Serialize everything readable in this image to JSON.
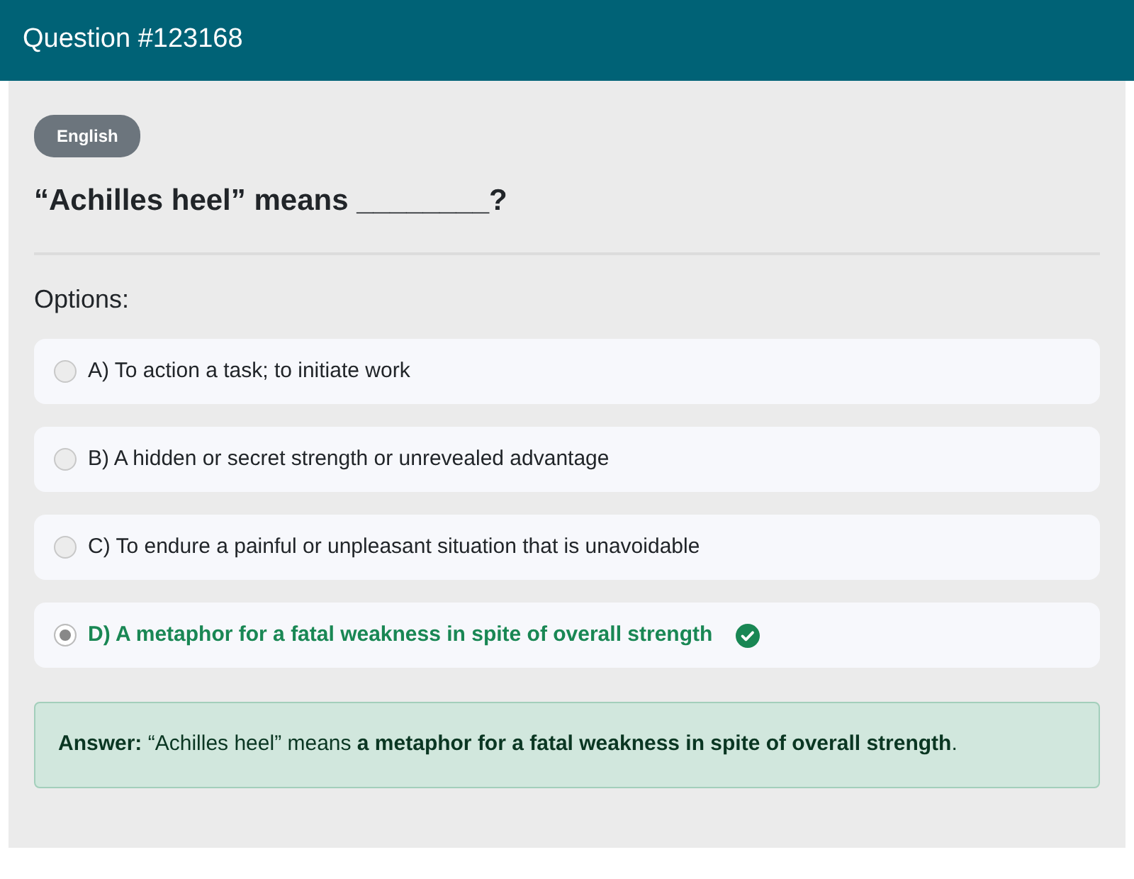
{
  "header": {
    "title": "Question #123168"
  },
  "category": "English",
  "question": "“Achilles heel” means ________?",
  "options_label": "Options:",
  "options": [
    {
      "label": "A) To action a task; to initiate work",
      "selected": false,
      "correct": false
    },
    {
      "label": "B) A hidden or secret strength or unrevealed advantage",
      "selected": false,
      "correct": false
    },
    {
      "label": "C) To endure a painful or unpleasant situation that is unavoidable",
      "selected": false,
      "correct": false
    },
    {
      "label": "D) A metaphor for a fatal weakness in spite of overall strength",
      "selected": true,
      "correct": true
    }
  ],
  "answer": "**Answer:** “Achilles heel” means **a metaphor for a fatal weakness in spite of overall strength**."
}
